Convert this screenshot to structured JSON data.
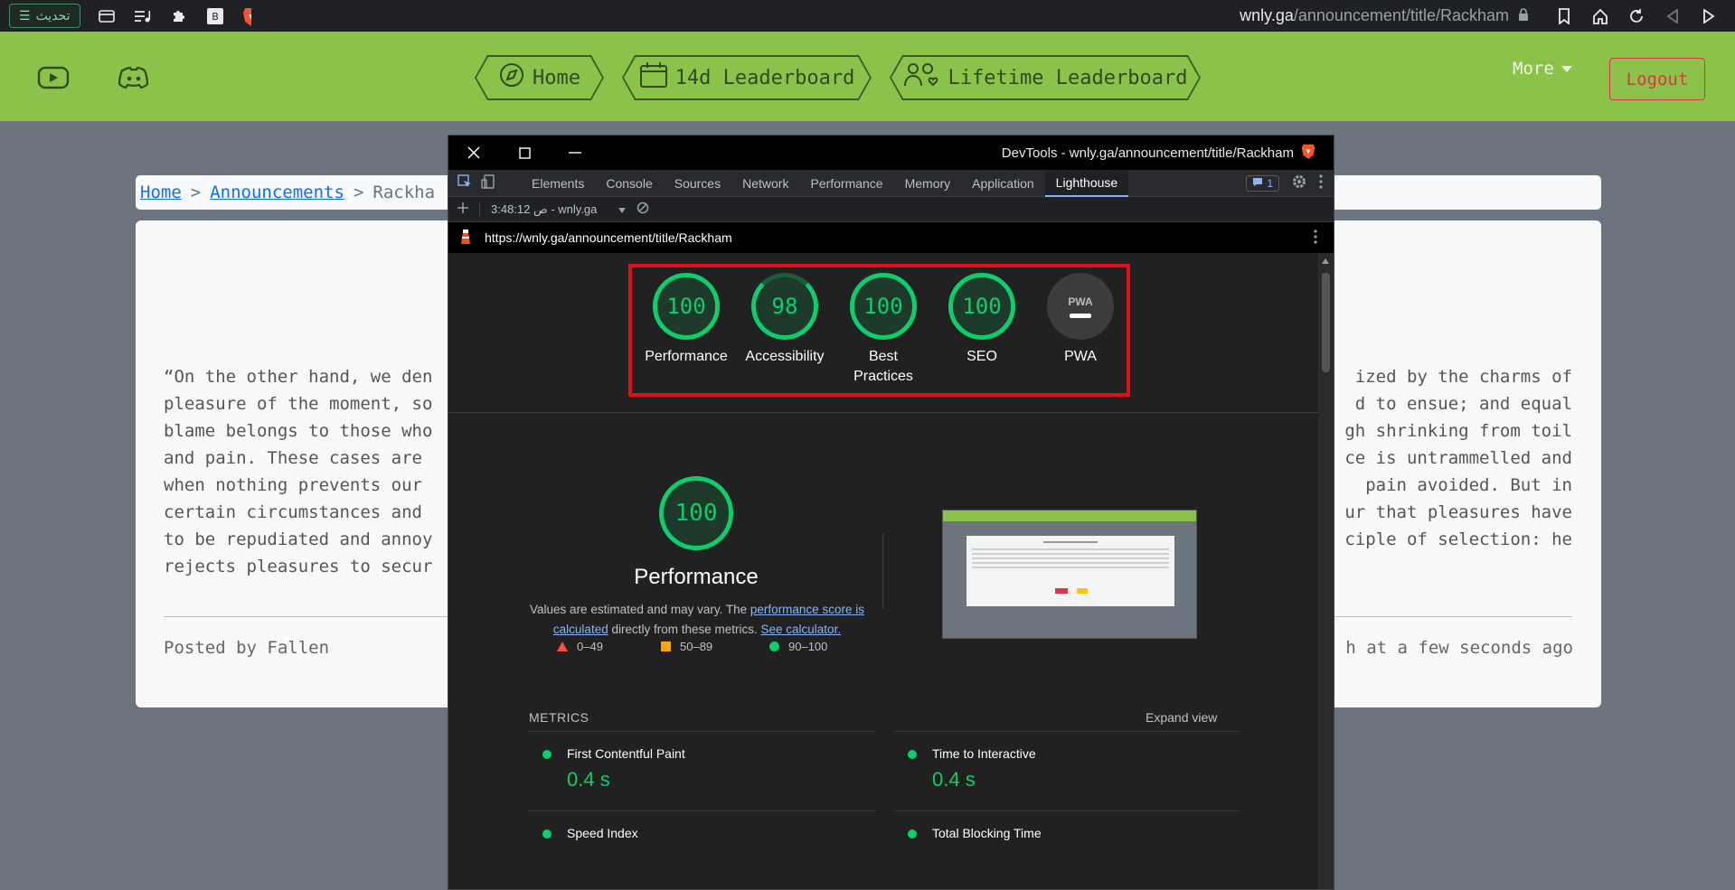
{
  "browser": {
    "update_label": "تحديث",
    "url_host": "wnly.ga",
    "url_path": "/announcement/title/Rackham"
  },
  "navbar": {
    "home": "Home",
    "leaderboard_14d": "14d Leaderboard",
    "lifetime_leaderboard": "Lifetime Leaderboard",
    "more": "More",
    "logout": "Logout"
  },
  "breadcrumb": {
    "home": "Home",
    "sep1": ">",
    "announcements": "Announcements",
    "sep2": ">",
    "current": "Rackha"
  },
  "article": {
    "body_left_lines": [
      "“On the other hand, we den",
      "pleasure of the moment, so",
      "blame belongs to those who",
      "and pain. These cases are",
      "when nothing prevents our",
      "certain circumstances and",
      "to be repudiated and annoy",
      "rejects pleasures to secur"
    ],
    "body_right_lines": [
      "ized by the charms of",
      "d to ensue; and equal",
      "gh shrinking from toil",
      "ce is untrammelled and",
      " pain avoided. But in",
      "ur that pleasures have",
      "ciple of selection: he",
      ""
    ],
    "posted_by": "Posted by Fallen",
    "posted_at": "h at a few seconds ago"
  },
  "devtools": {
    "title": "DevTools - wnly.ga/announcement/title/Rackham",
    "tabs": [
      "Elements",
      "Console",
      "Sources",
      "Network",
      "Performance",
      "Memory",
      "Application",
      "Lighthouse"
    ],
    "active_tab": "Lighthouse",
    "issues_count": "1",
    "report_time": "3:48:12 ص - wnly.ga",
    "report_url": "https://wnly.ga/announcement/title/Rackham"
  },
  "lighthouse": {
    "scores": [
      {
        "label": "Performance",
        "value": "100"
      },
      {
        "label": "Accessibility",
        "value": "98"
      },
      {
        "label": "Best Practices",
        "value": "100"
      },
      {
        "label": "SEO",
        "value": "100"
      }
    ],
    "pwa_label": "PWA",
    "pwa_badge": "PWA",
    "perf_score": "100",
    "perf_title": "Performance",
    "perf_desc_prefix": "Values are estimated and may vary. The ",
    "perf_desc_link1": "performance score is calculated",
    "perf_desc_mid": " directly from these metrics. ",
    "perf_desc_link2": "See calculator.",
    "legend": [
      "0–49",
      "50–89",
      "90–100"
    ],
    "metrics_heading": "METRICS",
    "expand_view": "Expand view",
    "metrics": [
      {
        "name": "First Contentful Paint",
        "value": "0.4 s"
      },
      {
        "name": "Time to Interactive",
        "value": "0.4 s"
      },
      {
        "name": "Speed Index",
        "value": ""
      },
      {
        "name": "Total Blocking Time",
        "value": ""
      }
    ]
  },
  "colors": {
    "navbar": "#8bc34a",
    "pass": "#0cce6b",
    "highlight": "#e0101a",
    "logout": "#dc3545"
  }
}
